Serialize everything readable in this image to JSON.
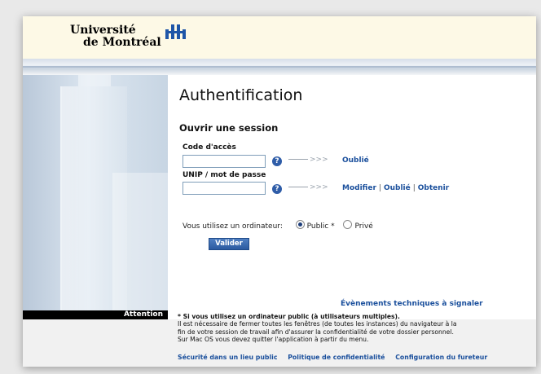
{
  "header": {
    "logo_line1": "Université",
    "logo_line2": "de Montréal"
  },
  "main": {
    "title": "Authentification",
    "subtitle": "Ouvrir une session",
    "access_code_label": "Code d'accès",
    "access_code_value": "",
    "access_forgot": "Oublié",
    "password_label": "UNIP / mot de passe",
    "password_value": "",
    "pw_modify": "Modifier",
    "pw_forgot": "Oublié",
    "pw_obtain": "Obtenir",
    "separator": "|",
    "help_glyph": "?",
    "arrow_glyph": ">>>",
    "computer_question": "Vous utilisez un ordinateur:",
    "radio_public": "Public *",
    "radio_private": "Privé",
    "selected": "public",
    "submit_label": "Valider"
  },
  "events_link": "Évènements techniques à signaler",
  "notice": {
    "label": "Attention",
    "line1": "* Si vous utilisez un ordinateur public (à utilisateurs multiples).",
    "line2": "Il est nécessaire de fermer toutes les fenêtres (de toutes les instances) du navigateur à la",
    "line3": "fin de votre session de travail afin d'assurer la confidentialité de votre dossier personnel.",
    "line4": "Sur Mac OS vous devez quitter l'application à partir du menu."
  },
  "footer": {
    "link1": "Sécurité dans un lieu public",
    "link2": "Politique de confidentialité",
    "link3": "Configuration du fureteur"
  },
  "colors": {
    "link": "#1a4f9c",
    "header_bg": "#fdf9e6",
    "logo_mark": "#1f56a8"
  },
  "icons": [
    "udem-logo-icon",
    "help-icon",
    "arrow-icon"
  ]
}
